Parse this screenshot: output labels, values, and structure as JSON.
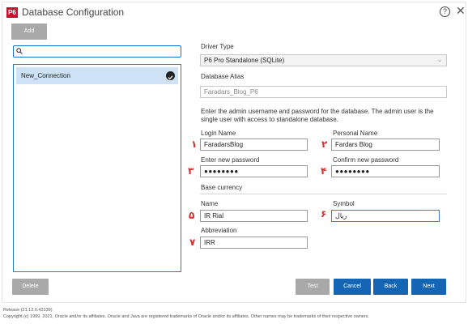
{
  "window": {
    "logo": "P6",
    "title": "Database Configuration",
    "help_icon": "question-circle-icon",
    "close_icon": "close-icon"
  },
  "left": {
    "add_label": "Add",
    "search_placeholder": "",
    "connections": [
      {
        "label": "New_Connection",
        "icon": "check-circle-icon"
      }
    ],
    "delete_label": "Delete"
  },
  "form": {
    "driver_type_label": "Driver Type",
    "driver_type_value": "P6 Pro Standalone (SQLite)",
    "alias_label": "Database Alias",
    "alias_value": "Faradars_Blog_P6",
    "admin_note": "Enter the admin username and password for the database. The admin user is the single user with access to standalone database.",
    "login_label": "Login Name",
    "login_value": "FaradarsBlog",
    "personal_label": "Personal Name",
    "personal_value": "Fardars Blog",
    "new_pwd_label": "Enter new password",
    "new_pwd_value": "●●●●●●●●",
    "confirm_pwd_label": "Confirm new password",
    "confirm_pwd_value": "●●●●●●●●",
    "currency_section": "Base currency",
    "name_label": "Name",
    "name_value": "IR Rial",
    "symbol_label": "Symbol",
    "symbol_value": "ریال",
    "abbrev_label": "Abbreviation",
    "abbrev_value": "IRR"
  },
  "annotations": {
    "n1": "۱",
    "n2": "۲",
    "n3": "۳",
    "n4": "۴",
    "n5": "۵",
    "n6": "۶",
    "n7": "۷"
  },
  "buttons": {
    "test": "Test",
    "cancel": "Cancel",
    "back": "Back",
    "next": "Next"
  },
  "footer": {
    "release": "Release (21.12.0.42339)",
    "copyright": "Copyright (c) 1999, 2021, Oracle and/or its affiliates. Oracle and Java are registered trademarks of Oracle and/or its affiliates. Other names may be trademarks of their respective owners."
  },
  "colors": {
    "accent": "#1565b5",
    "selection": "#cde3f5",
    "annotation": "#d32f2f",
    "disabled": "#a9a9a9"
  }
}
